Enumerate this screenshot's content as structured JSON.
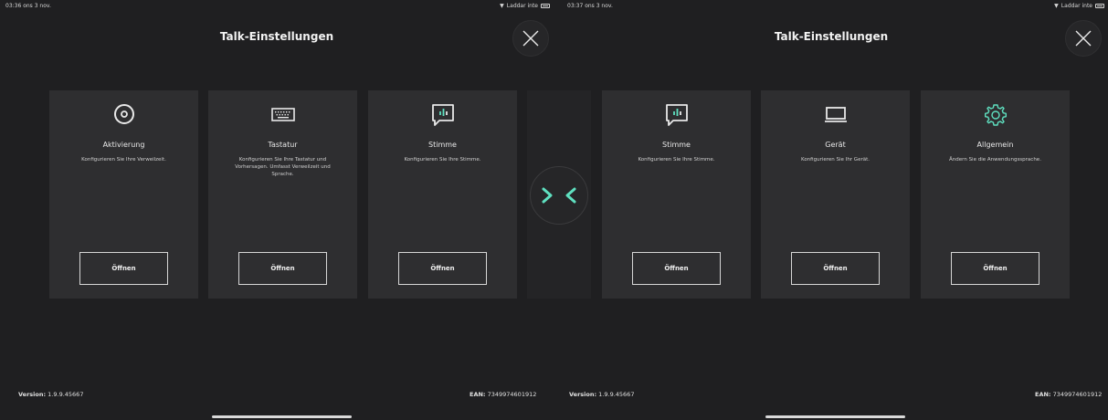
{
  "colors": {
    "accent": "#5fe0c0",
    "background": "#1f1f21",
    "card": "#2e2e30"
  },
  "left": {
    "status": {
      "time": "03:36  ons 3 nov.",
      "network": "Laddar inte"
    },
    "title": "Talk-Einstellungen",
    "cards": [
      {
        "icon": "target-icon",
        "title": "Aktivierung",
        "description": "Konfigurieren Sie Ihre Verweilzeit.",
        "button": "Öffnen"
      },
      {
        "icon": "keyboard-icon",
        "title": "Tastatur",
        "description": "Konfigurieren Sie Ihre Tastatur und Vorhersagen. Umfasst Verweilzeit und Sprache.",
        "button": "Öffnen"
      },
      {
        "icon": "voice-bubble-icon",
        "title": "Stimme",
        "description": "Konfigurieren Sie Ihre Stimme.",
        "button": "Öffnen"
      }
    ],
    "footer": {
      "version_label": "Version:",
      "version": "1.9.9.45667",
      "ean_label": "EAN:",
      "ean": "7349974601912"
    }
  },
  "right": {
    "status": {
      "time": "03:37  ons 3 nov.",
      "network": "Laddar inte"
    },
    "title": "Talk-Einstellungen",
    "cards": [
      {
        "icon": "voice-bubble-icon",
        "title": "Stimme",
        "description": "Konfigurieren Sie Ihre Stimme.",
        "button": "Öffnen"
      },
      {
        "icon": "monitor-icon",
        "title": "Gerät",
        "description": "Konfigurieren Sie Ihr Gerät.",
        "button": "Öffnen"
      },
      {
        "icon": "gear-icon",
        "title": "Allgemein",
        "description": "Ändern Sie die Anwendungssprache.",
        "button": "Öffnen"
      }
    ],
    "footer": {
      "version_label": "Version:",
      "version": "1.9.9.45667",
      "ean_label": "EAN:",
      "ean": "7349974601912"
    }
  }
}
